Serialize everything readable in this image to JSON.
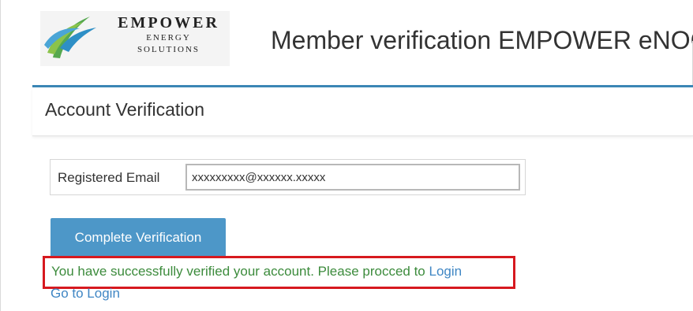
{
  "header": {
    "logo": {
      "brand": "EMPOWER",
      "line1": "ENERGY",
      "line2": "SOLUTIONS"
    },
    "page_title": "Member verification EMPOWER eNOC"
  },
  "panel": {
    "title": "Account Verification",
    "email": {
      "label": "Registered Email",
      "value": "xxxxxxxxx@xxxxxx.xxxxx"
    },
    "button": {
      "label": "Complete Verification"
    },
    "success": {
      "message_prefix": "You have successfully verified your account. Please procced to ",
      "login_link": "Login"
    },
    "go_to_login": "Go to Login"
  },
  "colors": {
    "accent": "#3b86b5",
    "button": "#4d97c8",
    "success_text": "#3c8b3c",
    "highlight_border": "#d7191f",
    "link": "#3f86c4"
  },
  "icons": {
    "logo": "empower-logo-icon"
  }
}
